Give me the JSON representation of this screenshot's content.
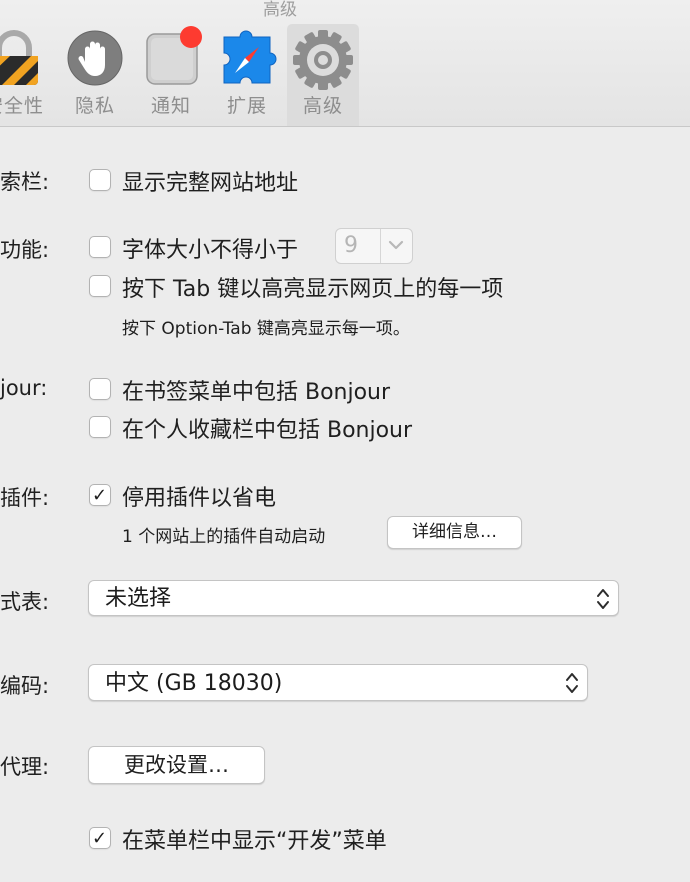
{
  "window": {
    "title": "高级"
  },
  "toolbar": {
    "items": [
      {
        "label": "安全性",
        "icon": "lock-icon"
      },
      {
        "label": "隐私",
        "icon": "hand-icon"
      },
      {
        "label": "通知",
        "icon": "notification-icon"
      },
      {
        "label": "扩展",
        "icon": "compass-puzzle-icon"
      },
      {
        "label": "高级",
        "icon": "gear-icon",
        "selected": true
      }
    ]
  },
  "settings": {
    "address_bar": {
      "label": "索栏:",
      "option": {
        "label": "显示完整网站地址",
        "checked": false
      }
    },
    "accessibility": {
      "label": "功能:",
      "min_font": {
        "label": "字体大小不得小于",
        "checked": false,
        "value": "9"
      },
      "tab_highlight": {
        "label": "按下 Tab 键以高亮显示网页上的每一项",
        "checked": false
      },
      "hint": "按下 Option-Tab 键高亮显示每一项。"
    },
    "bonjour": {
      "label": "jour:",
      "bookmarks_menu": {
        "label": "在书签菜单中包括 Bonjour",
        "checked": false
      },
      "favorites_bar": {
        "label": "在个人收藏栏中包括 Bonjour",
        "checked": false
      }
    },
    "plugins": {
      "label": "插件:",
      "power_saving": {
        "label": "停用插件以省电",
        "checked": true
      },
      "info": "1 个网站上的插件自动启动",
      "details_button": "详细信息…"
    },
    "stylesheet": {
      "label": "式表:",
      "value": "未选择"
    },
    "encoding": {
      "label": "编码:",
      "value": "中文 (GB 18030)"
    },
    "proxies": {
      "label": "代理:",
      "button": "更改设置…"
    },
    "develop_menu": {
      "label": "在菜单栏中显示“开发”菜单",
      "checked": true
    }
  },
  "colors": {
    "window_bg": "#ececec",
    "badge_red": "#fd3b30",
    "safari_blue": "#1b88ea"
  }
}
